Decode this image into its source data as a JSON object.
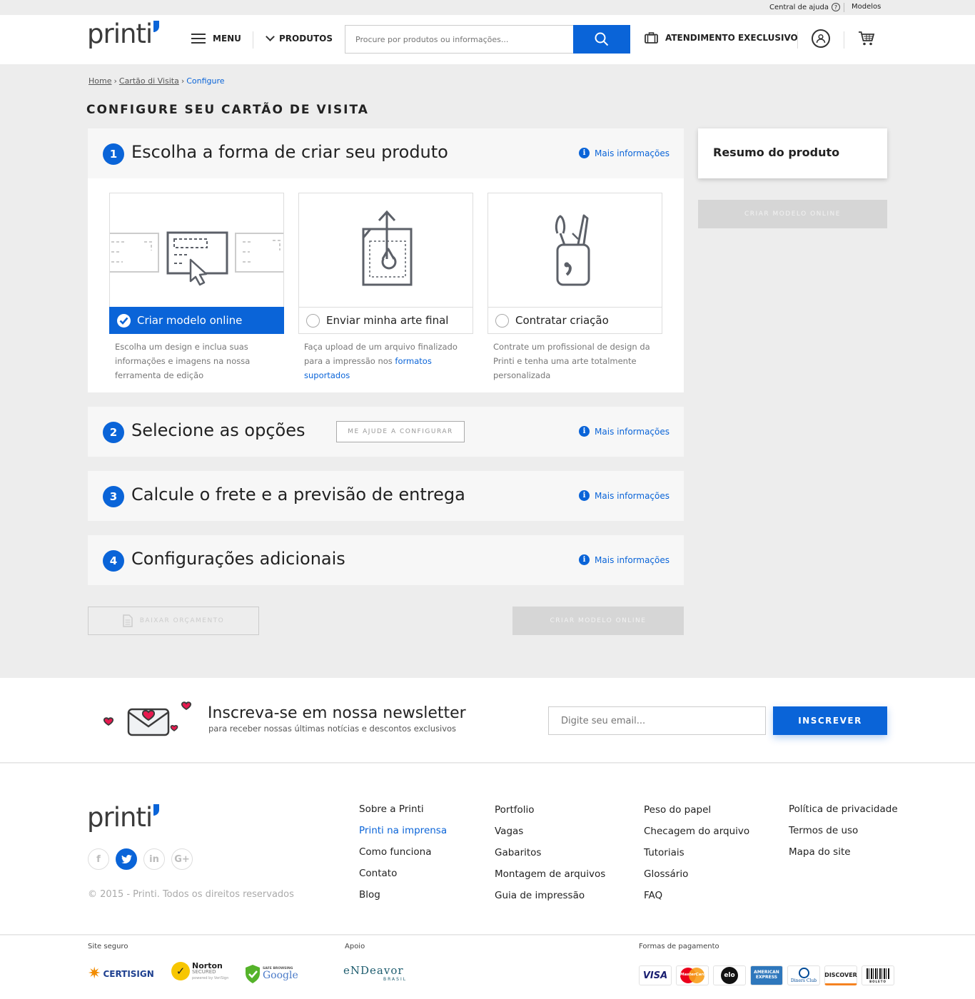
{
  "topbar": {
    "help": "Central de ajuda",
    "models": "Modelos"
  },
  "header": {
    "logo": "printi",
    "menu": "MENU",
    "products": "PRODUTOS",
    "search_placeholder": "Procure por produtos ou informações...",
    "attendance": "ATENDIMENTO EXECLUSIVO"
  },
  "breadcrumb": {
    "home": "Home",
    "category": "Cartão di Visita",
    "current": "Configure"
  },
  "page_title": "CONFIGURE SEU CARTÃO DE VISITA",
  "more_info": "Mais informações",
  "steps": [
    {
      "num": "1",
      "title": "Escolha a forma de criar seu produto"
    },
    {
      "num": "2",
      "title": "Selecione as opções",
      "help_button": "ME AJUDE A CONFIGURAR"
    },
    {
      "num": "3",
      "title": "Calcule o frete e a previsão de entrega"
    },
    {
      "num": "4",
      "title": "Configurações adicionais"
    }
  ],
  "options": [
    {
      "label": "Criar modelo online",
      "desc": "Escolha um design e inclua suas informações e imagens na nossa ferramenta de edição",
      "selected": true
    },
    {
      "label": "Enviar minha arte final",
      "desc": "Faça upload de um arquivo finalizado para a impressão nos",
      "link": "formatos suportados"
    },
    {
      "label": "Contratar criação",
      "desc": "Contrate um profissional de design da Printi e tenha uma arte totalmente personalizada"
    }
  ],
  "summary": {
    "title": "Resumo do produto",
    "button": "CRIAR MODELO ONLINE"
  },
  "actions": {
    "quote": "BAIXAR ORÇAMENTO",
    "create": "CRIAR MODELO ONLINE"
  },
  "newsletter": {
    "title": "Inscreva-se em nossa newsletter",
    "subtitle": "para receber nossas últimas notícias e descontos exclusivos",
    "placeholder": "Digite seu email...",
    "button": "INSCREVER"
  },
  "footer": {
    "social": [
      "f",
      "t",
      "in",
      "G+"
    ],
    "copyright": "© 2015 - Printi. Todos os direitos reservados",
    "col1": [
      "Sobre a Printi",
      "Printi na imprensa",
      "Como funciona",
      "Contato",
      "Blog"
    ],
    "col2": [
      "Portfolio",
      "Vagas",
      "Gabaritos",
      "Montagem de arquivos",
      "Guia de impressão"
    ],
    "col3": [
      "Peso do papel",
      "Checagem do arquivo",
      "Tutoriais",
      "Glossário",
      "FAQ"
    ],
    "col4": [
      "Política de privacidade",
      "Termos de uso",
      "Mapa do site"
    ]
  },
  "trust": {
    "secure_label": "Site seguro",
    "support_label": "Apoio",
    "payment_label": "Formas de pagamento",
    "secure_badges": [
      "CERTISIGN",
      "Norton",
      "SECURED",
      "powered by VeriSign",
      "SAFE BROWSING",
      "Google"
    ],
    "support_badge": "eNDeavor",
    "support_badge_sub": "BRASIL",
    "payments": [
      "VISA",
      "MasterCard",
      "elo",
      "AMERICAN EXPRESS",
      "Diners Club",
      "DISCOVER",
      "BOLETO"
    ]
  },
  "colors": {
    "accent": "#0a64d8",
    "background": "#ededed",
    "disabled": "#d6d6d6"
  }
}
